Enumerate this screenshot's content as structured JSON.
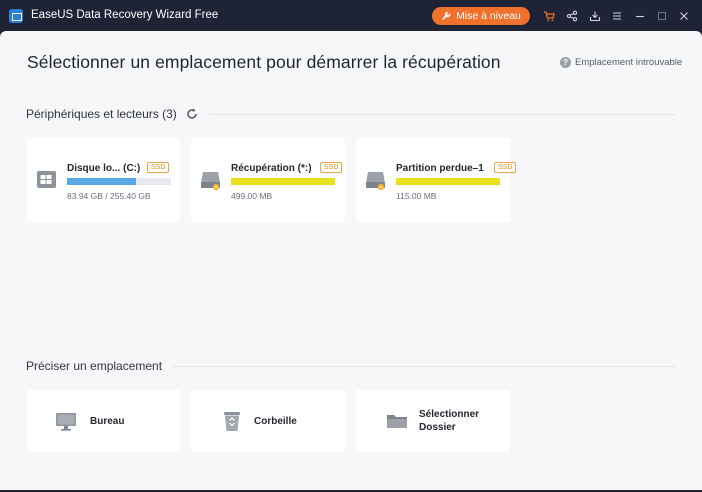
{
  "titlebar": {
    "app_title": "EaseUS Data Recovery Wizard Free",
    "upgrade_label": "Mise à niveau",
    "icons": [
      "cart-icon",
      "share-icon",
      "download-icon",
      "menu-icon",
      "minimize-icon",
      "maximize-icon",
      "close-icon"
    ]
  },
  "header": {
    "title": "Sélectionner un emplacement pour démarrer la récupération",
    "help_link": "Emplacement introuvable"
  },
  "devices": {
    "section_title": "Périphériques et lecteurs (3)",
    "drives": [
      {
        "name": "Disque lo... (C:)",
        "tag": "SSD",
        "usage": "83.94 GB / 255.40 GB",
        "fill_fraction": 0.66,
        "bar_color": "#5aa8e3",
        "icon": "windows-drive-icon"
      },
      {
        "name": "Récupération (*:)",
        "tag": "SSD",
        "usage": "499.00 MB",
        "fill_fraction": 1.0,
        "bar_color": "#e8e11b",
        "icon": "hard-drive-icon"
      },
      {
        "name": "Partition perdue–1",
        "tag": "SSD",
        "usage": "115.00 MB",
        "fill_fraction": 1.0,
        "bar_color": "#e8e11b",
        "icon": "hard-drive-icon"
      }
    ]
  },
  "locations": {
    "section_title": "Préciser un emplacement",
    "items": [
      {
        "label": "Bureau",
        "icon": "monitor-icon"
      },
      {
        "label": "Corbeille",
        "icon": "recycle-bin-icon"
      },
      {
        "label": "Sélectionner Dossier",
        "icon": "folder-icon"
      }
    ]
  },
  "colors": {
    "accent": "#f0712b",
    "titlebar": "#1e2436",
    "content_bg": "#f6f7f9",
    "card_bg": "#ffffff",
    "ssd_tag": "#e08c1a"
  }
}
